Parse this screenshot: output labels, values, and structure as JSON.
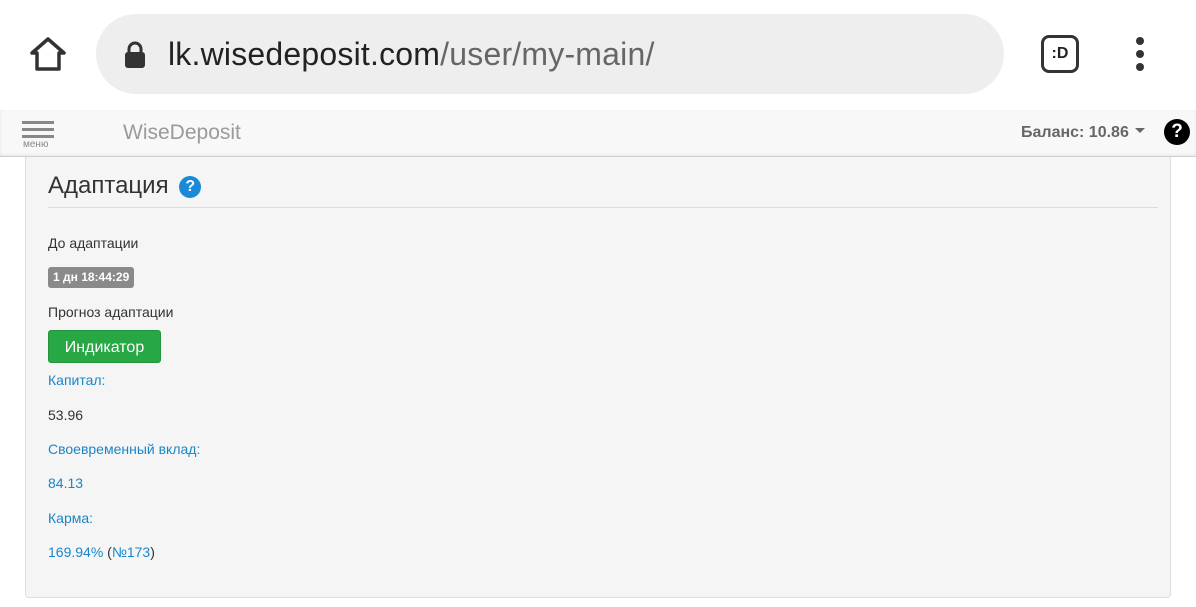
{
  "browser": {
    "url_host": "lk.wisedeposit.com",
    "url_path": "/user/my-main/",
    "tab_label": ":D"
  },
  "navbar": {
    "menu_label": "меню",
    "brand": "WiseDeposit",
    "balance": "Баланс: 10.86"
  },
  "panel": {
    "title": "Адаптация",
    "help_glyph": "?",
    "until_label": "До адаптации",
    "countdown": "1 дн 18:44:29",
    "forecast_label": "Прогноз адаптации",
    "indicator_button": "Индикатор",
    "capital_label": "Капитал:",
    "capital_value": "53.96",
    "timely_label": "Своевременный вклад:",
    "timely_value": "84.13",
    "karma_label": "Карма:",
    "karma_percent": "169.94%",
    "karma_rank": "№173"
  },
  "colors": {
    "link": "#1a86c8",
    "button_green": "#28a745",
    "help_blue": "#1a8ad8",
    "badge_gray": "#8a8a8a"
  }
}
